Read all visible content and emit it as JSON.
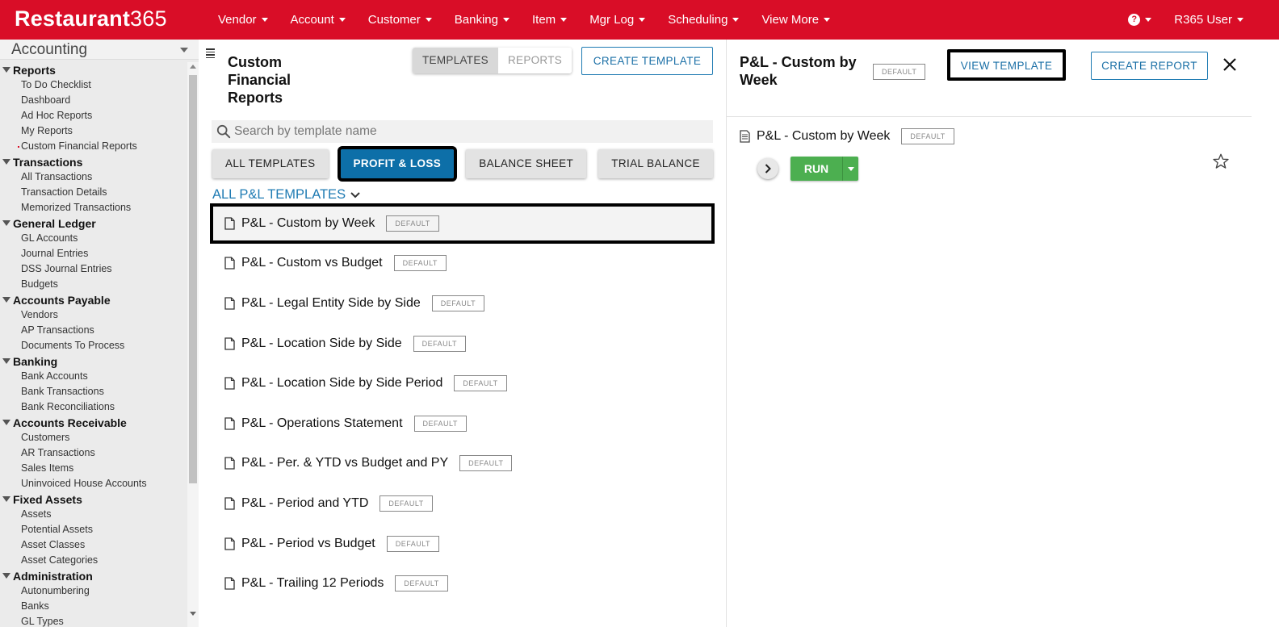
{
  "topbar": {
    "brand_text": "Restaurant",
    "brand_num": "365",
    "nav": [
      "Vendor",
      "Account",
      "Customer",
      "Banking",
      "Item",
      "Mgr Log",
      "Scheduling",
      "View More"
    ],
    "help_glyph": "?",
    "user_label": "R365 User"
  },
  "sidebar": {
    "module": "Accounting",
    "sections": [
      {
        "title": "Reports",
        "items": [
          "To Do Checklist",
          "Dashboard",
          "Ad Hoc Reports",
          "My Reports",
          "Custom Financial Reports"
        ]
      },
      {
        "title": "Transactions",
        "items": [
          "All Transactions",
          "Transaction Details",
          "Memorized Transactions"
        ]
      },
      {
        "title": "General Ledger",
        "items": [
          "GL Accounts",
          "Journal Entries",
          "DSS Journal Entries",
          "Budgets"
        ]
      },
      {
        "title": "Accounts Payable",
        "items": [
          "Vendors",
          "AP Transactions",
          "Documents To Process"
        ]
      },
      {
        "title": "Banking",
        "items": [
          "Bank Accounts",
          "Bank Transactions",
          "Bank Reconciliations"
        ]
      },
      {
        "title": "Accounts Receivable",
        "items": [
          "Customers",
          "AR Transactions",
          "Sales Items",
          "Uninvoiced House Accounts"
        ]
      },
      {
        "title": "Fixed Assets",
        "items": [
          "Assets",
          "Potential Assets",
          "Asset Classes",
          "Asset Categories"
        ]
      },
      {
        "title": "Administration",
        "items": [
          "Autonumbering",
          "Banks",
          "GL Types"
        ]
      }
    ],
    "active_item": "Custom Financial Reports"
  },
  "main": {
    "title": "Custom Financial Reports",
    "seg_templates": "TEMPLATES",
    "seg_reports": "REPORTS",
    "create_template": "CREATE TEMPLATE",
    "search_placeholder": "Search by template name",
    "filters": [
      "ALL TEMPLATES",
      "PROFIT & LOSS",
      "BALANCE SHEET",
      "TRIAL BALANCE"
    ],
    "active_filter": "PROFIT & LOSS",
    "subheading": "ALL P&L TEMPLATES",
    "badge": "DEFAULT",
    "templates": [
      "P&L - Custom by Week",
      "P&L - Custom vs Budget",
      "P&L - Legal Entity Side by Side",
      "P&L - Location Side by Side",
      "P&L - Location Side by Side Period",
      "P&L - Operations Statement",
      "P&L - Per. & YTD vs Budget and PY",
      "P&L - Period and YTD",
      "P&L - Period vs Budget",
      "P&L - Trailing 12 Periods"
    ],
    "selected_index": 0
  },
  "detail": {
    "title": "P&L - Custom by Week",
    "badge": "DEFAULT",
    "view_template": "VIEW TEMPLATE",
    "create_report": "CREATE REPORT",
    "item_name": "P&L - Custom by Week",
    "run_label": "RUN"
  },
  "icons": {
    "help": "help-icon",
    "search": "search-icon",
    "document": "document-icon",
    "close": "close-icon",
    "star": "star-icon",
    "chevron": "chevron-right-icon"
  },
  "colors": {
    "brand_red": "#d90d27",
    "primary_blue": "#0d6fa8",
    "link_blue": "#1f7bb3",
    "run_green": "#4caf50"
  }
}
